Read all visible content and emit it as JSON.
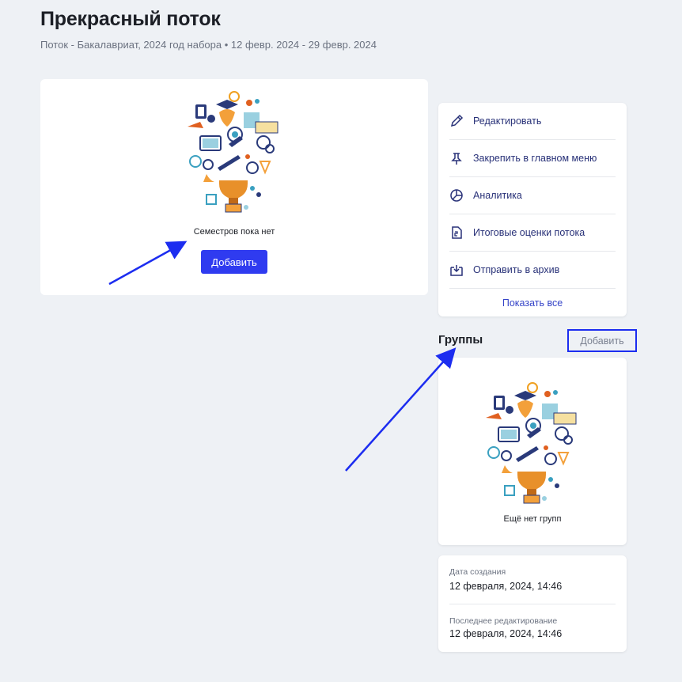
{
  "header": {
    "title": "Прекрасный поток",
    "subtitle": "Поток - Бакалавриат, 2024 год набора • 12 февр. 2024 - 29 февр. 2024"
  },
  "semesters": {
    "empty_text": "Семестров пока нет",
    "add_label": "Добавить"
  },
  "actions": {
    "items": [
      {
        "label": "Редактировать",
        "icon": "pencil-icon"
      },
      {
        "label": "Закрепить в главном меню",
        "icon": "pin-icon"
      },
      {
        "label": "Аналитика",
        "icon": "pie-chart-icon"
      },
      {
        "label": "Итоговые оценки потока",
        "icon": "grade-document-icon"
      },
      {
        "label": "Отправить в архив",
        "icon": "archive-icon"
      }
    ],
    "show_all": "Показать все"
  },
  "groups": {
    "title": "Группы",
    "add_label": "Добавить",
    "empty_text": "Ещё нет групп"
  },
  "meta": {
    "created_label": "Дата создания",
    "created_value": "12 февраля, 2024, 14:46",
    "edited_label": "Последнее редактирование",
    "edited_value": "12 февраля, 2024, 14:46"
  },
  "colors": {
    "primary": "#2f3bf0",
    "link": "#3544c8",
    "annotation": "#1c2df0"
  }
}
